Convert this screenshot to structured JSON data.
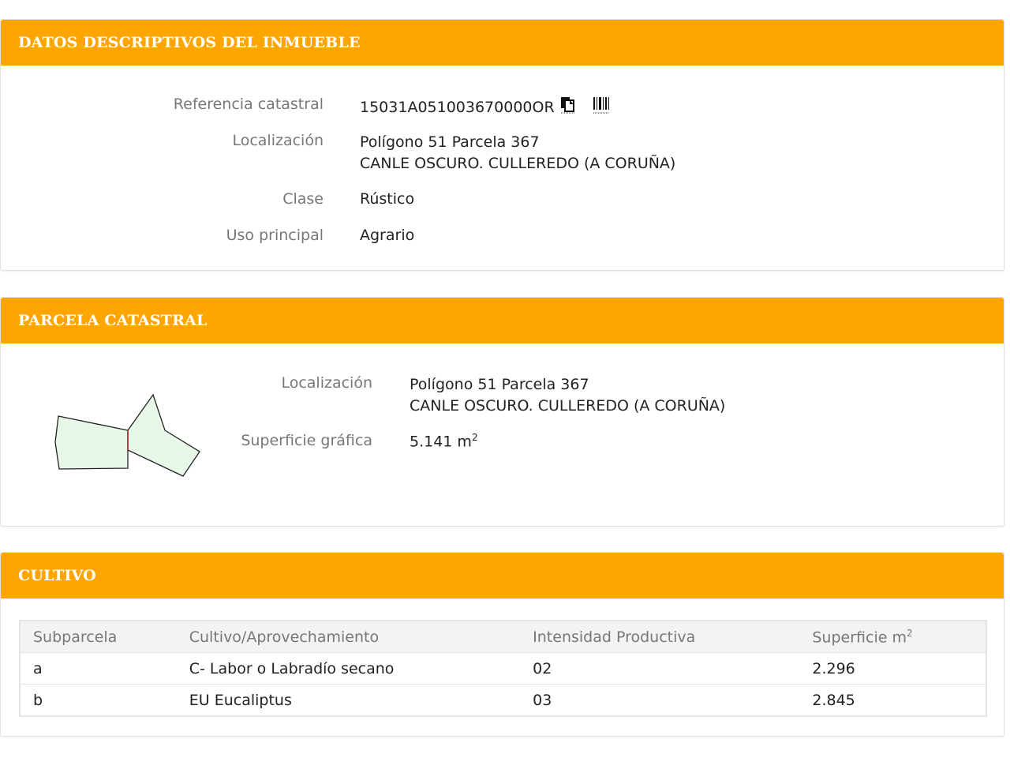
{
  "descriptivos": {
    "title": "DATOS DESCRIPTIVOS DEL INMUEBLE",
    "ref_label": "Referencia catastral",
    "ref_value": "15031A051003670000OR",
    "loc_label": "Localización",
    "loc_line1": "Polígono 51 Parcela 367",
    "loc_line2": "CANLE OSCURO. CULLEREDO (A CORUÑA)",
    "clase_label": "Clase",
    "clase_value": "Rústico",
    "uso_label": "Uso principal",
    "uso_value": "Agrario",
    "icons": [
      "copy-icon",
      "barcode-icon"
    ]
  },
  "parcela": {
    "title": "PARCELA CATASTRAL",
    "loc_label": "Localización",
    "loc_line1": "Polígono 51 Parcela 367",
    "loc_line2": "CANLE OSCURO. CULLEREDO (A CORUÑA)",
    "sup_label": "Superficie gráfica",
    "sup_value": "5.141 m",
    "sup_unit_exp": "2"
  },
  "cultivo": {
    "title": "CULTIVO",
    "headers": [
      "Subparcela",
      "Cultivo/Aprovechamiento",
      "Intensidad Productiva",
      "Superficie m"
    ],
    "header_exp": "2",
    "rows": [
      [
        "a",
        "C- Labor o Labradío secano",
        "02",
        "2.296"
      ],
      [
        "b",
        "EU Eucaliptus",
        "03",
        "2.845"
      ]
    ]
  },
  "colors": {
    "header": "#ffa500",
    "parcel_fill": "#e8f8e8",
    "divider": "#cc2222"
  }
}
